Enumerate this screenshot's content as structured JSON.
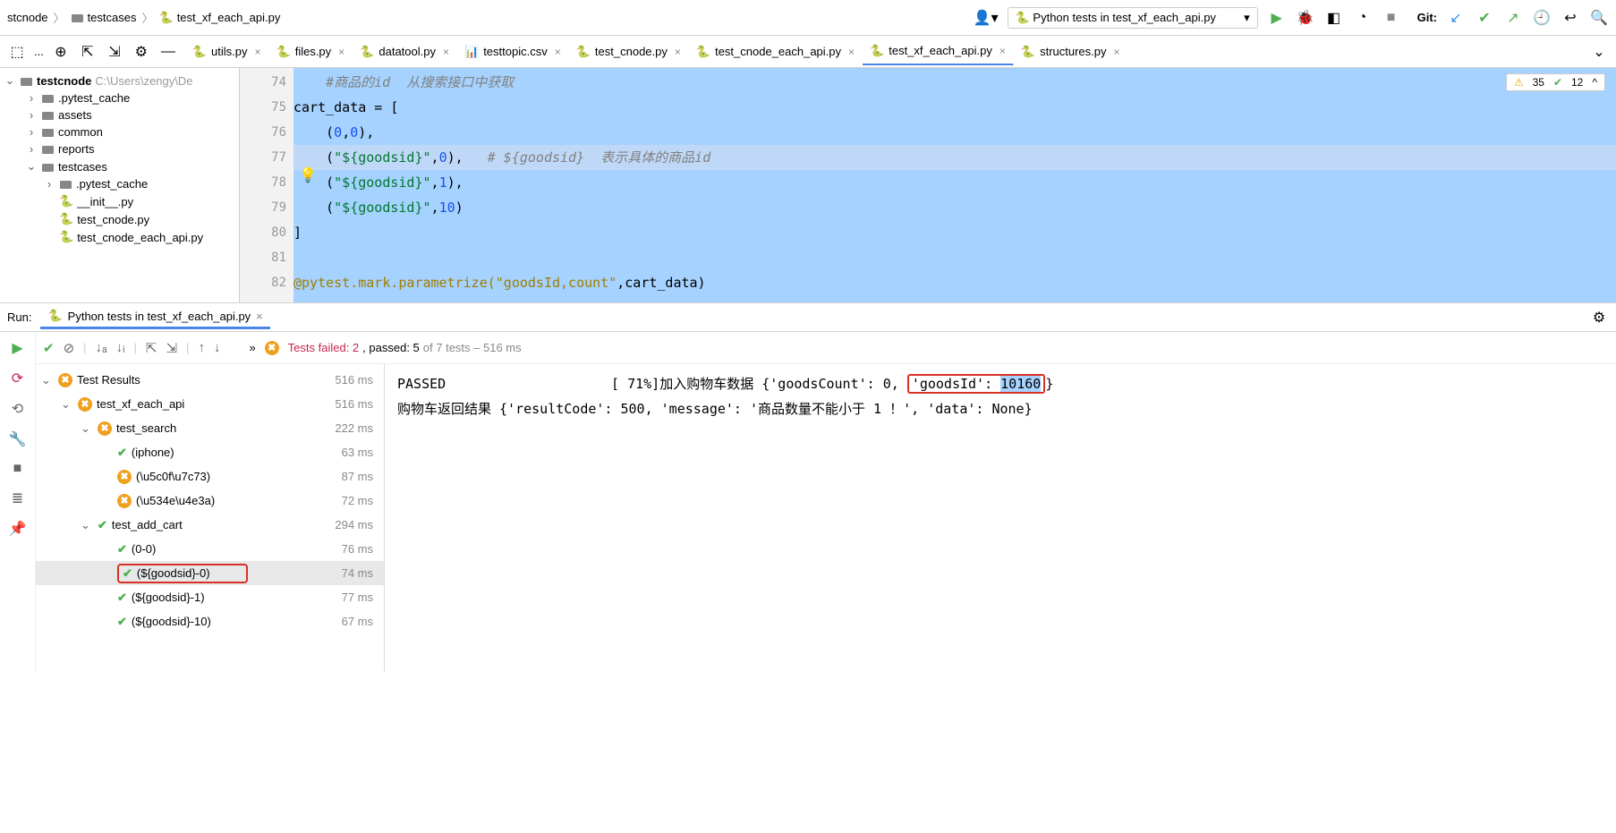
{
  "breadcrumb": {
    "parts": [
      "stcnode",
      "testcases",
      "test_xf_each_api.py"
    ]
  },
  "runConfig": {
    "label": "Python tests in test_xf_each_api.py"
  },
  "git": {
    "label": "Git:"
  },
  "toolbar": {
    "more": "..."
  },
  "tabs": [
    {
      "label": "utils.py",
      "type": "py"
    },
    {
      "label": "files.py",
      "type": "py"
    },
    {
      "label": "datatool.py",
      "type": "py"
    },
    {
      "label": "testtopic.csv",
      "type": "csv"
    },
    {
      "label": "test_cnode.py",
      "type": "py"
    },
    {
      "label": "test_cnode_each_api.py",
      "type": "py"
    },
    {
      "label": "test_xf_each_api.py",
      "type": "py",
      "active": true
    },
    {
      "label": "structures.py",
      "type": "py"
    }
  ],
  "tree": {
    "root": {
      "label": "testcnode",
      "path": "C:\\Users\\zengy\\De"
    },
    "items": [
      {
        "label": ".pytest_cache",
        "indent": 1,
        "exp": ">",
        "type": "folder"
      },
      {
        "label": "assets",
        "indent": 1,
        "exp": ">",
        "type": "folder"
      },
      {
        "label": "common",
        "indent": 1,
        "exp": ">",
        "type": "folder"
      },
      {
        "label": "reports",
        "indent": 1,
        "exp": ">",
        "type": "folder"
      },
      {
        "label": "testcases",
        "indent": 1,
        "exp": "v",
        "type": "folder"
      },
      {
        "label": ".pytest_cache",
        "indent": 2,
        "exp": ">",
        "type": "folder"
      },
      {
        "label": "__init__.py",
        "indent": 2,
        "exp": "",
        "type": "py"
      },
      {
        "label": "test_cnode.py",
        "indent": 2,
        "exp": "",
        "type": "py"
      },
      {
        "label": "test_cnode_each_api.py",
        "indent": 2,
        "exp": "",
        "type": "py"
      }
    ]
  },
  "editor": {
    "startLine": 74,
    "lines": [
      {
        "n": "74",
        "html": "    <span class='comment-it'>#商品的id  从搜索接口中获取</span>"
      },
      {
        "n": "75",
        "html": "cart_data = ["
      },
      {
        "n": "76",
        "html": "    (<span class='num-blue'>0</span>,<span class='num-blue'>0</span>),"
      },
      {
        "n": "77",
        "html": "    (<span class='kw-green'>\"${goodsid}\"</span>,<span class='num-blue'>0</span>),   <span class='comment-it'># ${goodsid}  表示具体的商品id</span>",
        "selected": true
      },
      {
        "n": "78",
        "html": "    (<span class='kw-green'>\"${goodsid}\"</span>,<span class='num-blue'>1</span>),"
      },
      {
        "n": "79",
        "html": "    (<span class='kw-green'>\"${goodsid}\"</span>,<span class='num-blue'>10</span>)"
      },
      {
        "n": "80",
        "html": "]"
      },
      {
        "n": "81",
        "html": ""
      },
      {
        "n": "82",
        "html": "<span class='deco-orange'>@pytest.mark.parametrize(\"goodsId,count\"</span>,cart_data)"
      }
    ],
    "inspections": {
      "warnings": "35",
      "typos": "12"
    }
  },
  "run": {
    "headerLabel": "Run:",
    "tabLabel": "Python tests in test_xf_each_api.py",
    "summary": {
      "bullet": "»",
      "failedLabel": "Tests failed: 2",
      "passedLabel": ", passed: 5",
      "total": " of 7 tests – 516 ms"
    },
    "tree": [
      {
        "label": "Test Results",
        "status": "fail",
        "dur": "516 ms",
        "indent": 0,
        "exp": "v"
      },
      {
        "label": "test_xf_each_api",
        "status": "fail",
        "dur": "516 ms",
        "indent": 1,
        "exp": "v"
      },
      {
        "label": "test_search",
        "status": "fail",
        "dur": "222 ms",
        "indent": 2,
        "exp": "v"
      },
      {
        "label": "(iphone)",
        "status": "pass",
        "dur": "63 ms",
        "indent": 3
      },
      {
        "label": "(\\u5c0f\\u7c73)",
        "status": "fail",
        "dur": "87 ms",
        "indent": 3
      },
      {
        "label": "(\\u534e\\u4e3a)",
        "status": "fail",
        "dur": "72 ms",
        "indent": 3
      },
      {
        "label": "test_add_cart",
        "status": "pass",
        "dur": "294 ms",
        "indent": 2,
        "exp": "v"
      },
      {
        "label": "(0-0)",
        "status": "pass",
        "dur": "76 ms",
        "indent": 3
      },
      {
        "label": "(${goodsid}-0)",
        "status": "pass",
        "dur": "74 ms",
        "indent": 3,
        "hl": true,
        "selected": true
      },
      {
        "label": "(${goodsid}-1)",
        "status": "pass",
        "dur": "77 ms",
        "indent": 3
      },
      {
        "label": "(${goodsid}-10)",
        "status": "pass",
        "dur": "67 ms",
        "indent": 3
      }
    ],
    "console": {
      "line1_pre": "PASSED",
      "line1_mid": "[ 71%]加入购物车数据 {'goodsCount': 0, ",
      "line1_hl": "'goodsId': 10160",
      "line1_post": "}",
      "line2": "购物车返回结果 {'resultCode': 500, 'message': '商品数量不能小于 1 ！', 'data': None}"
    }
  }
}
